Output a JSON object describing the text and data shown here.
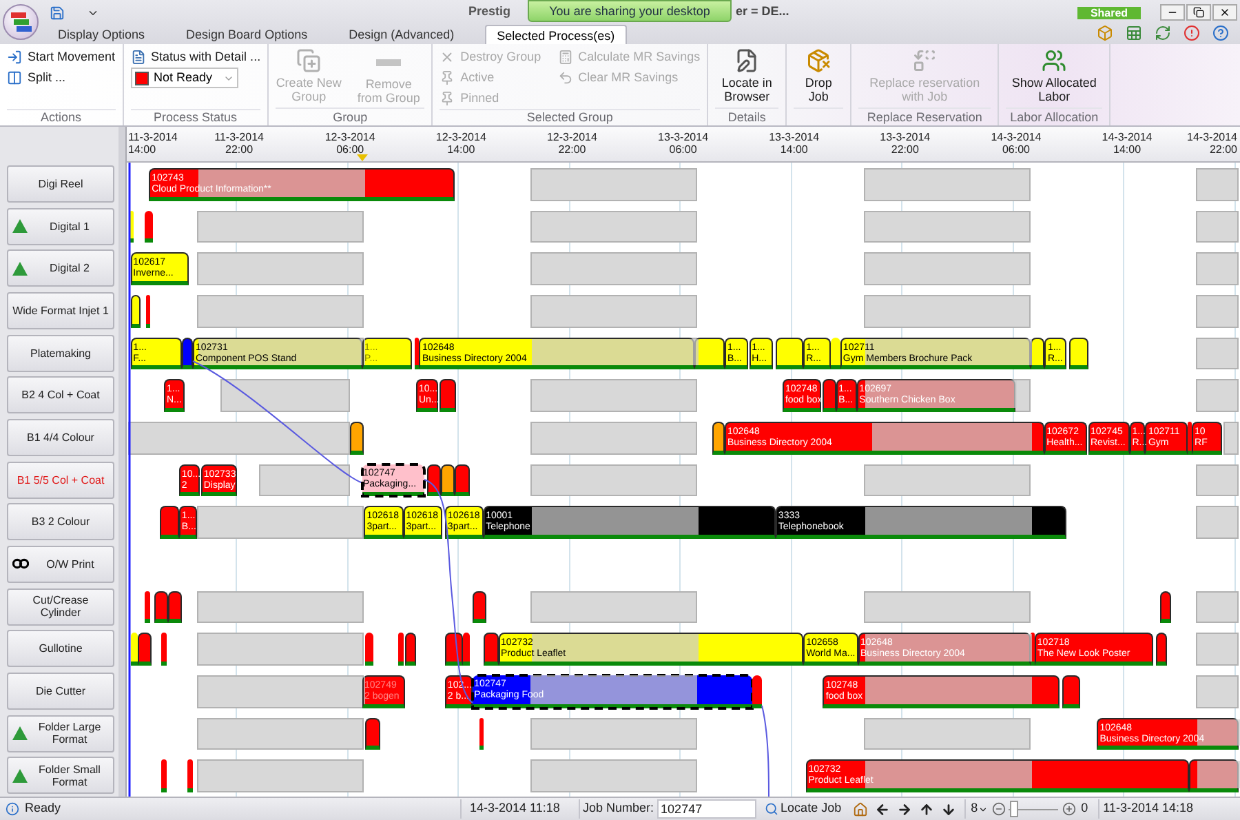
{
  "title_bar": {
    "title_start": "Prestig",
    "title_end": "er = DE...",
    "notification": "You are sharing your desktop",
    "badge": "Shared"
  },
  "tabs": [
    {
      "label": "Display Options",
      "selected": false
    },
    {
      "label": "Design Board Options",
      "selected": false
    },
    {
      "label": "Design (Advanced)",
      "selected": false
    },
    {
      "label": "Selected Process(es)",
      "selected": true
    }
  ],
  "ribbon": {
    "groups": [
      {
        "label": "Actions",
        "items": [
          {
            "label": "Start Movement",
            "kind": "small",
            "disabled": false
          },
          {
            "label": "Split ...",
            "kind": "small",
            "disabled": false
          }
        ]
      },
      {
        "label": "Process Status",
        "items": [
          {
            "label": "Status with Detail ...",
            "kind": "small",
            "disabled": false
          }
        ],
        "status_select": {
          "value": "Not Ready",
          "color": "#ff0000"
        }
      },
      {
        "label": "Group",
        "items": [
          {
            "label": "Create New Group",
            "kind": "large",
            "disabled": true
          },
          {
            "label": "Remove from Group",
            "kind": "large",
            "disabled": true
          }
        ]
      },
      {
        "label": "Selected Group",
        "items": [
          {
            "label": "Destroy Group",
            "kind": "small",
            "disabled": true
          },
          {
            "label": "Active",
            "kind": "small",
            "disabled": true
          },
          {
            "label": "Pinned",
            "kind": "small",
            "disabled": true
          },
          {
            "label": "Calculate MR Savings",
            "kind": "small",
            "disabled": true
          },
          {
            "label": "Clear MR Savings",
            "kind": "small",
            "disabled": true
          }
        ]
      },
      {
        "label": "Details",
        "items": [
          {
            "label": "Locate in Browser",
            "kind": "large",
            "disabled": false
          }
        ]
      },
      {
        "items": [
          {
            "label": "Drop Job",
            "kind": "large",
            "disabled": false
          }
        ]
      },
      {
        "label": "Replace Reservation",
        "items": [
          {
            "label": "Replace reservation with Job",
            "kind": "large",
            "disabled": true
          }
        ]
      },
      {
        "label": "Labor Allocation",
        "items": [
          {
            "label": "Show Allocated Labor",
            "kind": "large",
            "disabled": false
          }
        ]
      }
    ]
  },
  "timeline": {
    "ticks": [
      {
        "date": "11-3-2014",
        "time": "14:00"
      },
      {
        "date": "11-3-2014",
        "time": "22:00"
      },
      {
        "date": "12-3-2014",
        "time": "06:00"
      },
      {
        "date": "12-3-2014",
        "time": "14:00"
      },
      {
        "date": "12-3-2014",
        "time": "22:00"
      },
      {
        "date": "13-3-2014",
        "time": "06:00"
      },
      {
        "date": "13-3-2014",
        "time": "14:00"
      },
      {
        "date": "13-3-2014",
        "time": "22:00"
      },
      {
        "date": "14-3-2014",
        "time": "06:00"
      },
      {
        "date": "14-3-2014",
        "time": "14:00"
      },
      {
        "date": "14-3-2014",
        "time": "22:00"
      }
    ]
  },
  "resources": [
    {
      "label": "Digi Reel",
      "alert": false,
      "calendar": true,
      "bars": [
        {
          "color": "#ff0000",
          "selected": false,
          "number": "102743",
          "name": "Cloud Product Information**"
        }
      ]
    },
    {
      "label": "Digital 1",
      "alert": false,
      "calendar": true,
      "bars": [
        {
          "color": "#ffff00",
          "selected": false
        },
        {
          "color": "#ff0000",
          "selected": false
        }
      ]
    },
    {
      "label": "Digital 2",
      "alert": false,
      "calendar": true,
      "bars": [
        {
          "color": "#ffff00",
          "selected": false,
          "number": "102617",
          "name": "Inverne..."
        }
      ]
    },
    {
      "label": "Wide Format Injet 1",
      "alert": false,
      "calendar": true,
      "bars": [
        {
          "color": "#ffff00",
          "selected": false
        },
        {
          "color": "#ff0000",
          "selected": false
        }
      ]
    },
    {
      "label": "Platemaking",
      "alert": false,
      "calendar": true,
      "bars": [
        {
          "color": "#ffff00",
          "selected": false,
          "number": "1...",
          "name": "F..."
        },
        {
          "color": "#0000ff",
          "selected": false
        },
        {
          "color": "#ffff00",
          "selected": false,
          "number": "102731",
          "name": "Component POS Stand"
        },
        {
          "color": "#ffff00",
          "selected": false,
          "number": "1...",
          "name": "P..."
        },
        {
          "color": "#ff0000",
          "selected": false
        },
        {
          "color": "#ffff00",
          "selected": false,
          "number": "102648",
          "name": "Business Directory 2004"
        },
        {
          "color": "#ffff00",
          "selected": false
        },
        {
          "color": "#ffff00",
          "selected": false,
          "number": "1...",
          "name": "B..."
        },
        {
          "color": "#ffff00",
          "selected": false,
          "number": "1...",
          "name": "H..."
        },
        {
          "color": "#ffff00",
          "selected": false
        },
        {
          "color": "#ffff00",
          "selected": false,
          "number": "1...",
          "name": "R..."
        },
        {
          "color": "#ffff00",
          "selected": false
        },
        {
          "color": "#ffff00",
          "selected": false,
          "number": "102711",
          "name": "Gym Members Brochure Pack"
        },
        {
          "color": "#ffff00",
          "selected": false
        },
        {
          "color": "#ffff00",
          "selected": false,
          "number": "1...",
          "name": "R..."
        },
        {
          "color": "#ffff00",
          "selected": false
        }
      ]
    },
    {
      "label": "B2 4 Col + Coat",
      "alert": false,
      "calendar": true,
      "bars": [
        {
          "color": "#ff0000",
          "selected": false,
          "number": "1...",
          "name": "N..."
        },
        {
          "color": "#ff0000",
          "selected": false,
          "number": "10...",
          "name": "Un..."
        },
        {
          "color": "#ff0000",
          "selected": false
        },
        {
          "color": "#ff0000",
          "selected": false,
          "number": "102748",
          "name": "food box"
        },
        {
          "color": "#ff0000",
          "selected": false
        },
        {
          "color": "#ff0000",
          "selected": false,
          "number": "1...",
          "name": "B..."
        },
        {
          "color": "#ff0000",
          "selected": false,
          "number": "102697",
          "name": "Southern Chicken Box"
        }
      ]
    },
    {
      "label": "B1 4/4 Colour",
      "alert": false,
      "calendar": true,
      "bars": [
        {
          "color": "#ffa500",
          "selected": false
        },
        {
          "color": "#ffa500",
          "selected": false
        },
        {
          "color": "#ff0000",
          "selected": false,
          "number": "102648",
          "name": "Business Directory 2004"
        },
        {
          "color": "#ff0000",
          "selected": false,
          "number": "102672",
          "name": "Health..."
        },
        {
          "color": "#ff0000",
          "selected": false,
          "number": "102745",
          "name": "Revist..."
        },
        {
          "color": "#ff0000",
          "selected": false,
          "number": "1...",
          "name": "R..."
        },
        {
          "color": "#ff0000",
          "selected": false,
          "number": "102711",
          "name": "Gym"
        },
        {
          "color": "#ff0000",
          "selected": false
        },
        {
          "color": "#ff0000",
          "selected": false,
          "number": "10",
          "name": "RF"
        }
      ]
    },
    {
      "label": "B1 5/5 Col + Coat",
      "alert": true,
      "calendar": true,
      "bars": [
        {
          "color": "#ff0000",
          "selected": false,
          "number": "10...",
          "name": "2"
        },
        {
          "color": "#ff0000",
          "selected": false,
          "number": "102733",
          "name": "Display"
        },
        {
          "color": "#ffc0cb",
          "selected": true,
          "number": "102747",
          "name": "Packaging..."
        },
        {
          "color": "#ff0000",
          "selected": false
        },
        {
          "color": "#ffa500",
          "selected": false
        },
        {
          "color": "#ff0000",
          "selected": false
        }
      ]
    },
    {
      "label": "B3 2 Colour",
      "alert": false,
      "calendar": true,
      "bars": [
        {
          "color": "#ff0000",
          "selected": false
        },
        {
          "color": "#ff0000",
          "selected": false,
          "number": "1...",
          "name": "B..."
        },
        {
          "color": "#ffff00",
          "selected": false,
          "number": "102618",
          "name": "3part..."
        },
        {
          "color": "#ffff00",
          "selected": false,
          "number": "102618",
          "name": "3part..."
        },
        {
          "color": "#ffff00",
          "selected": false,
          "number": "102618",
          "name": "3part..."
        },
        {
          "color": "#000000",
          "selected": false,
          "number": "10001",
          "name": "Telephone"
        },
        {
          "color": "#000000",
          "selected": false,
          "number": "3333",
          "name": "Telephonebook"
        }
      ]
    },
    {
      "label": "O/W Print",
      "alert": false,
      "calendar": false
    },
    {
      "label": "Cut/Crease Cylinder",
      "alert": false,
      "calendar": true,
      "bars": [
        {
          "color": "#ff0000",
          "selected": false
        },
        {
          "color": "#ff0000",
          "selected": false
        },
        {
          "color": "#ff0000",
          "selected": false
        },
        {
          "color": "#ff0000",
          "selected": false
        },
        {
          "color": "#ff0000",
          "selected": false
        }
      ]
    },
    {
      "label": "Gullotine",
      "alert": false,
      "calendar": true,
      "bars": [
        {
          "color": "#ffff00",
          "selected": false
        },
        {
          "color": "#ff0000",
          "selected": false
        },
        {
          "color": "#ff0000",
          "selected": false
        },
        {
          "color": "#ff0000",
          "selected": false
        },
        {
          "color": "#ff0000",
          "selected": false
        },
        {
          "color": "#ff0000",
          "selected": false
        },
        {
          "color": "#ff0000",
          "selected": false
        },
        {
          "color": "#ff0000",
          "selected": false
        },
        {
          "color": "#ff0000",
          "selected": false
        },
        {
          "color": "#ffff00",
          "selected": false,
          "number": "102732",
          "name": "Product Leaflet"
        },
        {
          "color": "#ffff00",
          "selected": false,
          "number": "102658",
          "name": "World Ma..."
        },
        {
          "color": "#ff0000",
          "selected": false,
          "number": "102648",
          "name": "Business Directory 2004"
        },
        {
          "color": "#ff0000",
          "selected": false
        },
        {
          "color": "#ff0000",
          "selected": false,
          "number": "102718",
          "name": "The New Look Poster"
        },
        {
          "color": "#ff0000",
          "selected": false
        }
      ]
    },
    {
      "label": "Die Cutter",
      "alert": false,
      "calendar": true,
      "bars": [
        {
          "color": "#ff0000",
          "selected": false,
          "number": "102749",
          "name": "2 bogen"
        },
        {
          "color": "#ff0000",
          "selected": false,
          "number": "102...",
          "name": "2 b..."
        },
        {
          "color": "#0000ff",
          "selected": true,
          "number": "102747",
          "name": "Packaging Food"
        },
        {
          "color": "#ff0000",
          "selected": false
        },
        {
          "color": "#ff0000",
          "selected": false,
          "number": "102748",
          "name": "food box"
        },
        {
          "color": "#ff0000",
          "selected": false
        }
      ]
    },
    {
      "label": "Folder Large Format",
      "alert": false,
      "calendar": true,
      "bars": [
        {
          "color": "#ff0000",
          "selected": false
        },
        {
          "color": "#ff0000",
          "selected": false
        },
        {
          "color": "#ff0000",
          "selected": false,
          "number": "102648",
          "name": "Business Directory 2004"
        }
      ]
    },
    {
      "label": "Folder Small Format",
      "alert": false,
      "calendar": true,
      "bars": [
        {
          "color": "#ff0000",
          "selected": false
        },
        {
          "color": "#ff0000",
          "selected": false
        },
        {
          "color": "#ff0000",
          "selected": false,
          "number": "102732",
          "name": "Product Leaflet"
        },
        {
          "color": "#ff0000",
          "selected": false
        }
      ]
    }
  ],
  "status_bar": {
    "status": "Ready",
    "now": "14-3-2014 11:18",
    "job_label": "Job Number:",
    "job_value": "102747",
    "locate": "Locate Job",
    "step": "8",
    "zoom": {
      "level": 0.05
    },
    "zoom_value": "0",
    "view_start": "11-3-2014 14:18"
  }
}
